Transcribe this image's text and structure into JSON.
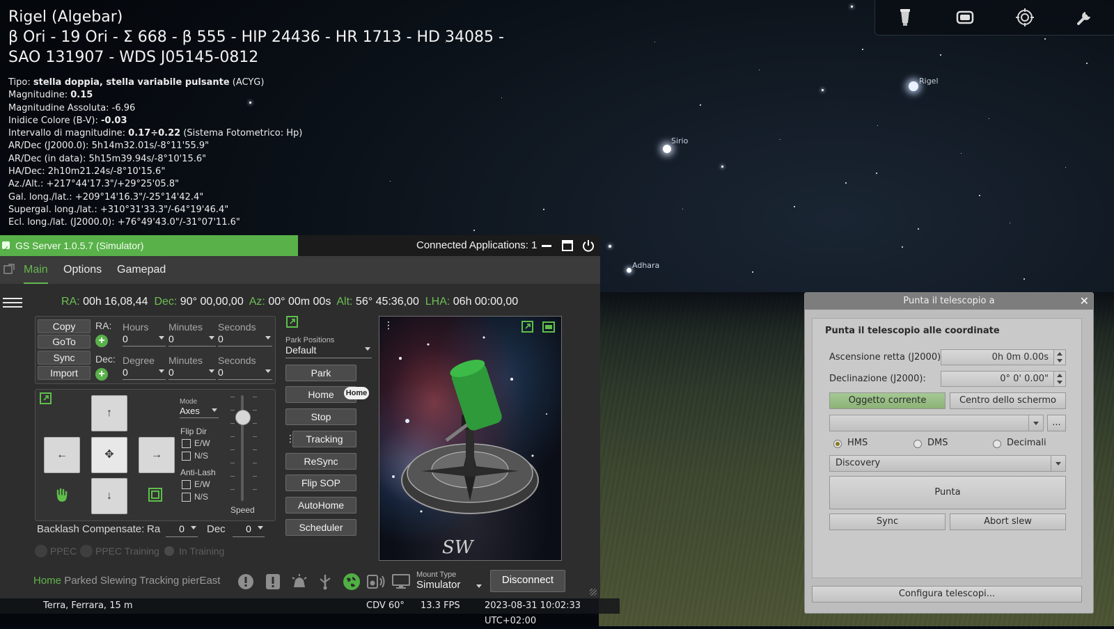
{
  "object_info": {
    "title_lines": [
      "Rigel (Algebar)",
      "β Ori - 19 Ori - Σ 668 - β 555 - HIP 24436 - HR 1713 - HD 34085 -",
      "SAO 131907 - WDS J05145-0812"
    ],
    "tipo_label": "Tipo: ",
    "tipo_value": "stella doppia, stella variabile pulsante",
    "tipo_suffix": " (ACYG)",
    "mag_label": "Magnitudine: ",
    "mag_value": "0.15",
    "abs_mag": "Magnitudine Assoluta: -6.96",
    "color_label": "Inidice Colore (B-V): ",
    "color_value": "-0.03",
    "range_label": "Intervallo di magnitudine: ",
    "range_value": "0.17÷0.22",
    "range_suffix": " (Sistema Fotometrico: Hp)",
    "radec_j2000": "AR/Dec (J2000.0): 5h14m32.01s/-8°11'55.9\"",
    "radec_date": "AR/Dec (in data): 5h15m39.94s/-8°10'15.6\"",
    "hadec": "HA/Dec: 2h10m21.24s/-8°10'15.6\"",
    "azalt": "Az./Alt.: +217°44'17.3\"/+29°25'05.8\"",
    "gal": "Gal. long./lat.: +209°14'16.3\"/-25°14'42.4\"",
    "supergal": "Supergal. long./lat.: +310°31'33.3\"/-64°19'46.4\"",
    "ecl_j2000": "Ecl. long./lat. (J2000.0): +76°49'43.0\"/-31°07'11.6\""
  },
  "sky_labels": {
    "rigel": "Rigel",
    "sirio": "Sirio",
    "adhara": "Adhara"
  },
  "top_toolbar": {
    "icons": [
      "telescope-icon",
      "ocular-icon",
      "sensor-icon",
      "wrench-icon"
    ]
  },
  "gs_server": {
    "title": "GS Server 1.0.5.7 (Simulator)",
    "connected": "Connected Applications: 1",
    "tabs": [
      "Main",
      "Options",
      "Gamepad"
    ],
    "active_tab": "Main",
    "coords": {
      "ra_label": "RA:",
      "ra_value": "00h 16,08,44",
      "dec_label": "Dec:",
      "dec_value": "90° 00,00,00",
      "az_label": "Az:",
      "az_value": "00° 00m 00s",
      "alt_label": "Alt:",
      "alt_value": "56° 45:36,00",
      "lha_label": "LHA:",
      "lha_value": "06h 00:00,00"
    },
    "goto_buttons": [
      "Copy",
      "GoTo",
      "Sync",
      "Import"
    ],
    "ra_row": {
      "label": "RA:",
      "h_label": "Hours",
      "m_label": "Minutes",
      "s_label": "Seconds",
      "h": "0",
      "m": "0",
      "s": "0"
    },
    "dec_row": {
      "label": "Dec:",
      "d_label": "Degree",
      "m_label": "Minutes",
      "s_label": "Seconds",
      "d": "0",
      "m": "0",
      "s": "0"
    },
    "park": {
      "label": "Park Positions",
      "value": "Default"
    },
    "actions": [
      "Park",
      "Home",
      "Stop",
      "Tracking",
      "ReSync",
      "Flip SOP",
      "AutoHome",
      "Scheduler"
    ],
    "home_badge": "Home",
    "mode": {
      "label": "Mode",
      "value": "Axes"
    },
    "flip_dir": {
      "label": "Flip Dir",
      "ew": "E/W",
      "ns": "N/S"
    },
    "anti_lash": {
      "label": "Anti-Lash",
      "ew": "E/W",
      "ns": "N/S"
    },
    "speed_label": "Speed",
    "speed_level": 0.85,
    "backlash": {
      "label": "Backlash Compensate:",
      "ra_label": "Ra",
      "ra_value": "0",
      "dec_label": "Dec",
      "dec_value": "0"
    },
    "ppec": {
      "ppec": "PPEC",
      "training": "PPEC Training",
      "in_training": "In Training"
    },
    "status_words": {
      "home": "Home",
      "rest": "Parked Slewing Tracking pierEast"
    },
    "mount_type": {
      "label": "Mount Type",
      "value": "Simulator"
    },
    "disconnect": "Disconnect"
  },
  "bottom_bar": {
    "location": "Terra, Ferrara, 15 m",
    "fov": "CDV 60°",
    "fps": "13.3 FPS",
    "datetime": "2023-08-31 10:02:33 UTC+02:00"
  },
  "dialog": {
    "title": "Punta il telescopio a",
    "heading": "Punta il telescopio alle coordinate",
    "ra_label": "Ascensione retta (J2000):",
    "ra_value": "0h 0m 0.00s",
    "dec_label": "Declinazione (J2000):",
    "dec_value": "0° 0' 0.00\"",
    "btn_current": "Oggetto corrente",
    "btn_center": "Centro dello schermo",
    "more": "...",
    "formats": [
      "HMS",
      "DMS",
      "Decimali"
    ],
    "selected_format": "HMS",
    "telescope": "Discovery",
    "punta": "Punta",
    "sync": "Sync",
    "abort": "Abort slew",
    "configure": "Configura telescopi..."
  }
}
